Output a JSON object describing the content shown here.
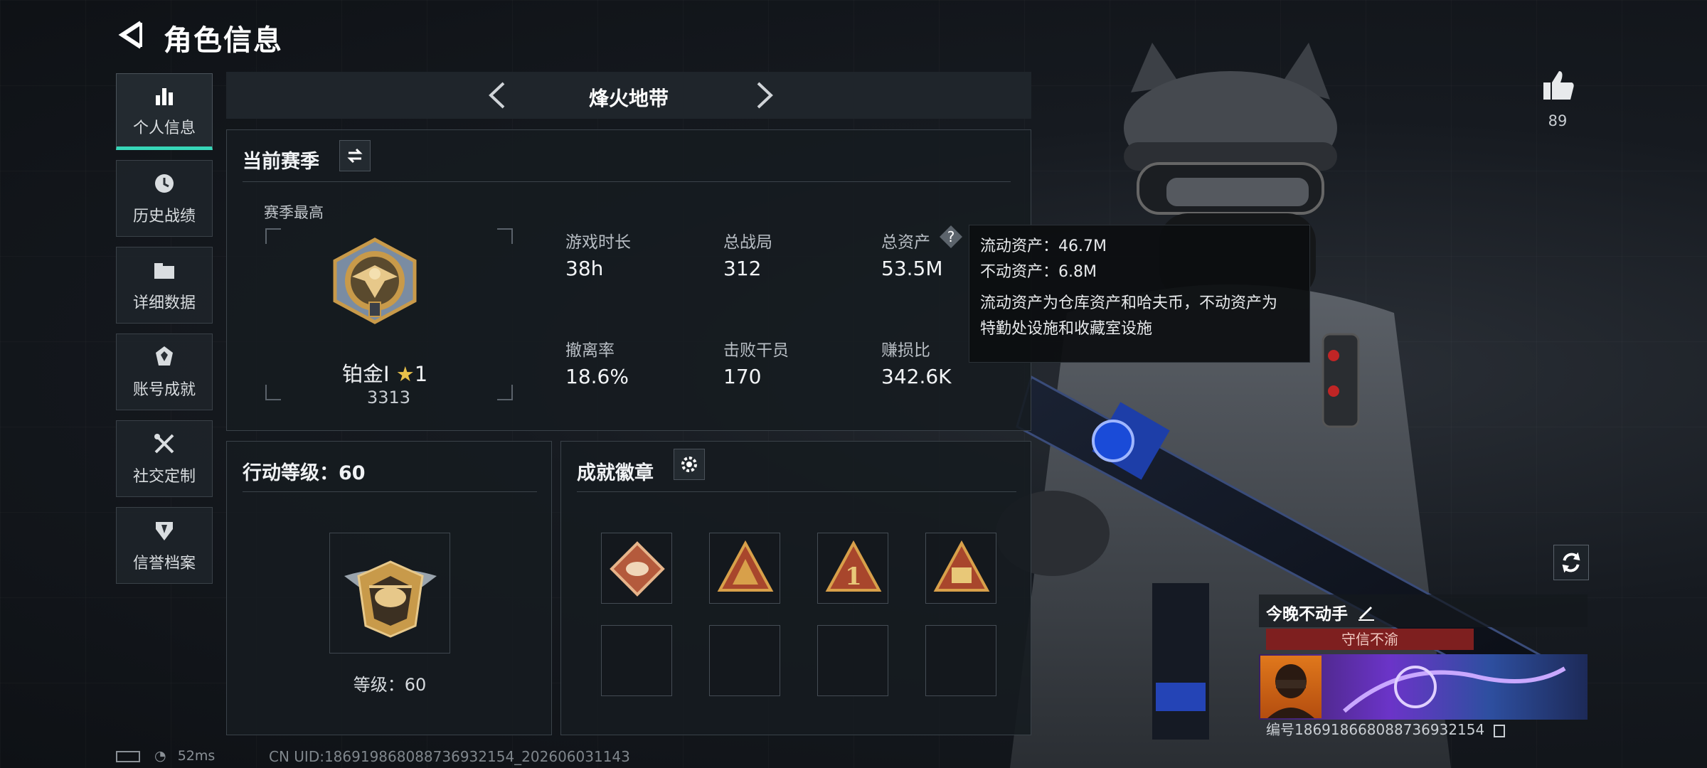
{
  "header": {
    "title": "角色信息"
  },
  "nav": [
    {
      "label": "个人信息",
      "icon": "bar-chart-icon",
      "active": true
    },
    {
      "label": "历史战绩",
      "icon": "clock-icon"
    },
    {
      "label": "详细数据",
      "icon": "folder-icon"
    },
    {
      "label": "账号成就",
      "icon": "medal-icon"
    },
    {
      "label": "社交定制",
      "icon": "wrench-icon"
    },
    {
      "label": "信誉档案",
      "icon": "shield-icon"
    }
  ],
  "mode": {
    "title": "烽火地带"
  },
  "season": {
    "title": "当前赛季",
    "best_label": "赛季最高",
    "rank_name": "铂金I",
    "rank_stars": "1",
    "rank_score": "3313",
    "stats": [
      {
        "label": "游戏时长",
        "value": "38h"
      },
      {
        "label": "总战局",
        "value": "312"
      },
      {
        "label": "总资产",
        "value": "53.5M"
      },
      {
        "label": "撤离率",
        "value": "18.6%"
      },
      {
        "label": "击败干员",
        "value": "170"
      },
      {
        "label": "赚损比",
        "value": "342.6K"
      }
    ]
  },
  "tooltip": {
    "liquid": "流动资产：46.7M",
    "fixed": "不动资产：6.8M",
    "desc_line1": "流动资产为仓库资产和哈夫币，不动资产为",
    "desc_line2": "特勤处设施和收藏室设施"
  },
  "action_level": {
    "title": "行动等级：60",
    "level_text": "等级：60"
  },
  "achievements": {
    "title": "成就徽章"
  },
  "likes": {
    "count": "89"
  },
  "player": {
    "name": "今晚不动手",
    "title": "守信不渝",
    "id": "编号18691866808873693215​4"
  },
  "status": {
    "ping": "52ms"
  },
  "uid": "CN UID:186919868088736932154_202606031143",
  "colors": {
    "accent": "#37d6b8",
    "title_red": "#7e1f1f",
    "gold": "#c89a4a"
  }
}
